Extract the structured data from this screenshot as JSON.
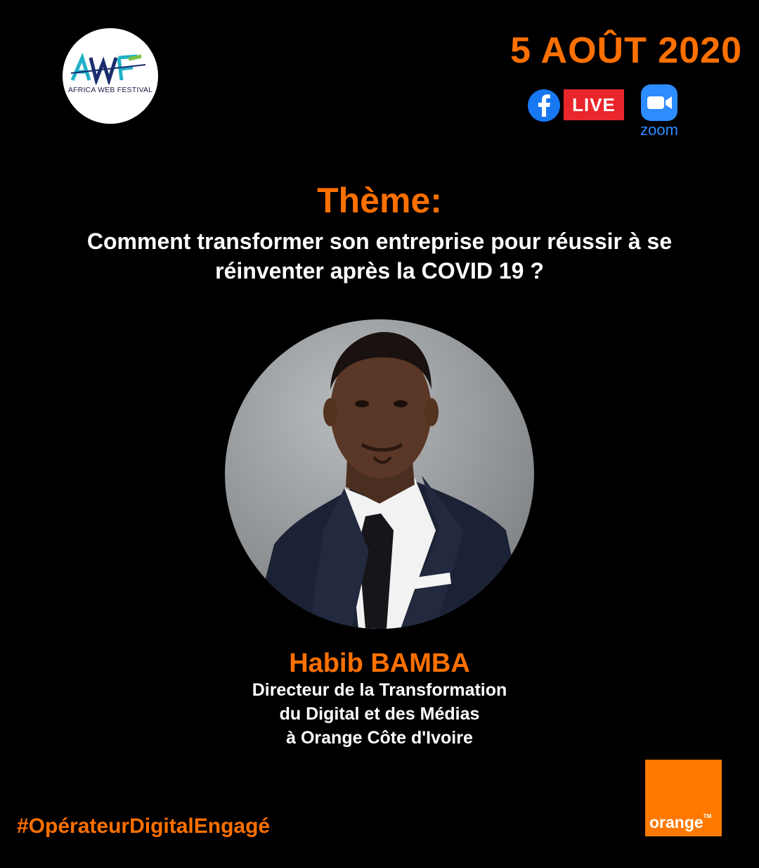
{
  "header": {
    "logo_text": "AFRICA WEB FESTIVAL",
    "logo_mark": "AWF",
    "date": "5 AOÛT 2020",
    "live_label": "LIVE",
    "zoom_label": "zoom"
  },
  "theme": {
    "label": "Thème:",
    "question_line1": "Comment transformer son entreprise pour réussir à se",
    "question_line2": "réinventer après la COVID 19 ?"
  },
  "speaker": {
    "name": "Habib BAMBA",
    "role_line1": "Directeur de la Transformation",
    "role_line2": "du Digital et des Médias",
    "role_line3": "à Orange Côte d'Ivoire"
  },
  "footer": {
    "hashtag": "#OpérateurDigitalEngagé",
    "brand": "orange",
    "trademark": "TM"
  },
  "colors": {
    "accent": "#ff7000",
    "background": "#000000",
    "live_red": "#e8262b",
    "facebook_blue": "#1877f2",
    "zoom_blue": "#2d8cff"
  }
}
